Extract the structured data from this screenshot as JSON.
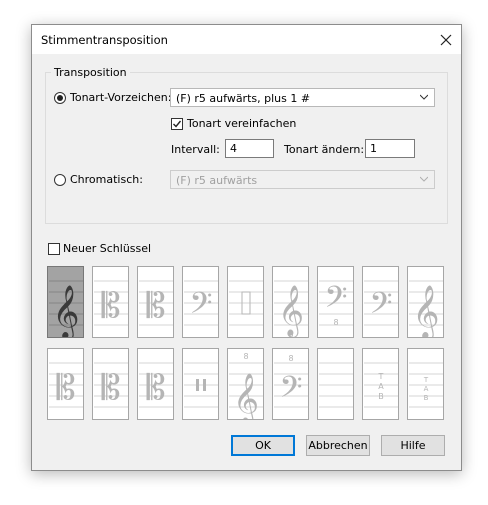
{
  "dialog": {
    "title": "Stimmentransposition",
    "close_icon": "close-icon"
  },
  "transposition": {
    "group_label": "Transposition",
    "key_signature": {
      "label": "Tonart-Vorzeichen:",
      "selected": true,
      "value": "(F) r5 aufwärts, plus 1 #"
    },
    "simplify_key": {
      "label": "Tonart vereinfachen",
      "checked": true
    },
    "interval": {
      "label": "Intervall:",
      "value": "4"
    },
    "key_change": {
      "label": "Tonart ändern:",
      "value": "1"
    },
    "chromatic": {
      "label": "Chromatisch:",
      "selected": false,
      "value": "(F) r5 aufwärts"
    }
  },
  "new_clef": {
    "label": "Neuer Schlüssel",
    "checked": false,
    "clefs": [
      "treble-clef",
      "alto-c-clef",
      "tenor-c-clef",
      "bass-clef-high",
      "percussion-clef",
      "treble-8vb-clef",
      "bass-8vb-clef",
      "bass-clef",
      "treble-clef-small",
      "soprano-c-clef",
      "baritone-c-clef",
      "bass-c-clef",
      "percussion-clef-2",
      "treble-8va-clef",
      "bass-8va-clef",
      "blank-clef",
      "tab-clef",
      "tab-clef-small"
    ],
    "selected_index": 0
  },
  "buttons": {
    "ok": "OK",
    "cancel": "Abbrechen",
    "help": "Hilfe"
  }
}
